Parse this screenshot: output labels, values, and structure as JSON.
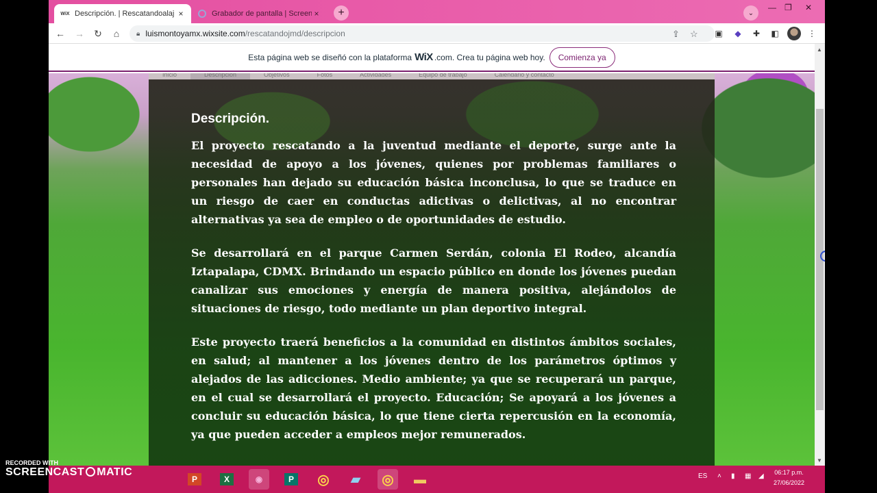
{
  "browser": {
    "tabs": [
      {
        "favicon": "WiX",
        "title": "Descripción. | Rescatandoalaj",
        "close": "×",
        "active": true
      },
      {
        "favicon": "record-icon",
        "title": "Grabador de pantalla | Screencas",
        "close": "×",
        "active": false
      }
    ],
    "new_tab": "+",
    "tab_search": "⌄",
    "window_controls": [
      "—",
      "❐",
      "✕"
    ],
    "url_host": "luismontoyamx.wixsite.com",
    "url_path": "/rescatandojmd/descripcion"
  },
  "wix_banner": {
    "text_before": "Esta página web se diseñó con la plataforma",
    "brand": "WiX",
    "text_after": ".com. Crea tu página web hoy.",
    "button": "Comienza ya"
  },
  "site_nav": [
    "Inicio",
    "Descripción",
    "Objetivos",
    "Fotos",
    "Actividades",
    "Equipo de trabajo",
    "Calendario y contacto"
  ],
  "content": {
    "heading": "Descripción.",
    "paragraphs": [
      "El proyecto rescatando a la juventud mediante el deporte, surge ante la necesidad de apoyo a los jóvenes, quienes por problemas familiares o personales han dejado su educación básica inconclusa, lo que se traduce en un riesgo  de caer en conductas adictivas o delictivas, al no encontrar alternativas ya sea de empleo o de oportunidades de estudio.",
      "Se desarrollará en el parque Carmen Serdán, colonia El Rodeo, alcandía Iztapalapa, CDMX. Brindando un espacio público en donde los jóvenes puedan canalizar sus  emociones y energía de manera positiva, alejándolos de situaciones de riesgo, todo mediante un plan deportivo integral.",
      "Este proyecto traerá beneficios a la comunidad en distintos ámbitos sociales, en salud; al mantener a los jóvenes dentro de los parámetros óptimos y alejados de las adicciones. Medio ambiente; ya que se recuperará un parque, en el cual se desarrollará el proyecto. Educación; Se apoyará a los jóvenes a concluir su educación básica, lo que tiene cierta repercusión en la economía, ya que pueden acceder a empleos mejor remunerados."
    ]
  },
  "watermark": {
    "line1": "RECORDED WITH",
    "line2": "SCREENCAST",
    "line3": "MATIC"
  },
  "taskbar": {
    "apps": [
      {
        "name": "powerpoint-icon",
        "label": "P",
        "color": "#d24726"
      },
      {
        "name": "excel-icon",
        "label": "X",
        "color": "#1d6f42"
      },
      {
        "name": "media-icon",
        "label": "◉",
        "color": "#a04080"
      },
      {
        "name": "publisher-icon",
        "label": "P",
        "color": "#077568"
      },
      {
        "name": "chrome-icon",
        "label": "◎",
        "color": "#db4437"
      },
      {
        "name": "notes-icon",
        "label": "▰",
        "color": "#5fa0d0"
      },
      {
        "name": "chrome-active-icon",
        "label": "◎",
        "color": "#db4437"
      },
      {
        "name": "folder-icon",
        "label": "▬",
        "color": "#e8b84a"
      }
    ],
    "lang": "ES",
    "time": "06:17 p.m.",
    "date": "27/06/2022"
  }
}
